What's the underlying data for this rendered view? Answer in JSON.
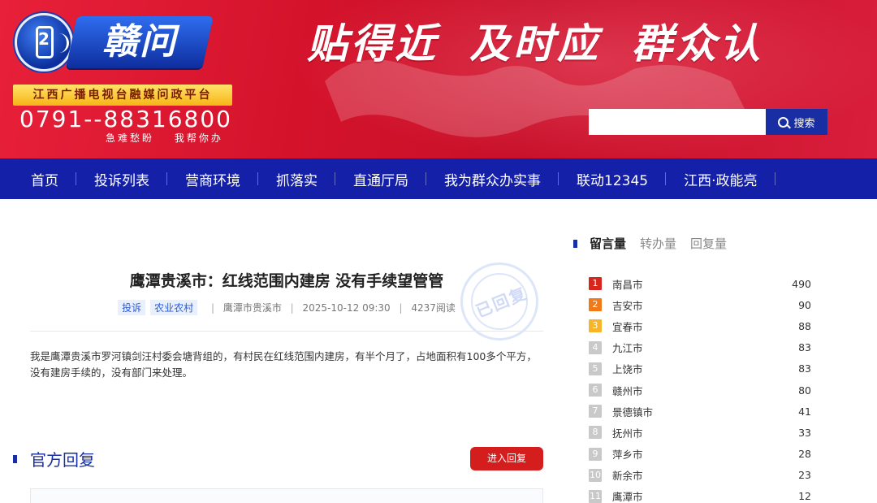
{
  "brand": {
    "logo_number": "2",
    "logo_title": "赣问",
    "platform": "江西广播电视台融媒问政平台",
    "hotline": "0791--88316800",
    "hotline_sub": [
      "急难愁盼",
      "我帮你办"
    ]
  },
  "slogan": [
    "贴得近",
    "及时应",
    "群众认"
  ],
  "search": {
    "value": "",
    "placeholder": "",
    "button_label": "搜索"
  },
  "nav": [
    "首页",
    "投诉列表",
    "营商环境",
    "抓落实",
    "直通厅局",
    "我为群众办实事",
    "联动12345",
    "江西·政能亮"
  ],
  "article": {
    "title": "鹰潭贵溪市：红线范围内建房 没有手续望管管",
    "tags": [
      "投诉",
      "农业农村"
    ],
    "location": "鹰潭市贵溪市",
    "datetime": "2025-10-12 09:30",
    "reads": "4237阅读",
    "stamp": "已回复",
    "body": "我是鹰潭贵溪市罗河镇剑汪村委会塘背组的，有村民在红线范围内建房，有半个月了，占地面积有100多个平方，没有建房手续的，没有部门来处理。"
  },
  "reply": {
    "title": "官方回复",
    "button_label": "进入回复"
  },
  "sidebar": {
    "tabs": [
      "留言量",
      "转办量",
      "回复量"
    ],
    "active_tab": "留言量",
    "ranking": [
      {
        "rank": "1",
        "city": "南昌市",
        "count": "490",
        "color": "#d9261c"
      },
      {
        "rank": "2",
        "city": "吉安市",
        "count": "90",
        "color": "#f07a1a"
      },
      {
        "rank": "3",
        "city": "宜春市",
        "count": "88",
        "color": "#f6b52a"
      },
      {
        "rank": "4",
        "city": "九江市",
        "count": "83",
        "color": "#c9c9c9"
      },
      {
        "rank": "5",
        "city": "上饶市",
        "count": "83",
        "color": "#c9c9c9"
      },
      {
        "rank": "6",
        "city": "赣州市",
        "count": "80",
        "color": "#c9c9c9"
      },
      {
        "rank": "7",
        "city": "景德镇市",
        "count": "41",
        "color": "#c9c9c9"
      },
      {
        "rank": "8",
        "city": "抚州市",
        "count": "33",
        "color": "#c9c9c9"
      },
      {
        "rank": "9",
        "city": "萍乡市",
        "count": "28",
        "color": "#c9c9c9"
      },
      {
        "rank": "10",
        "city": "新余市",
        "count": "23",
        "color": "#c9c9c9"
      },
      {
        "rank": "11",
        "city": "鹰潭市",
        "count": "12",
        "color": "#c9c9c9"
      }
    ]
  },
  "colors": {
    "brand_red": "#d4132b",
    "nav_blue": "#1520a8",
    "accent_blue": "#1a2ea3",
    "button_red": "#d41e1e"
  }
}
